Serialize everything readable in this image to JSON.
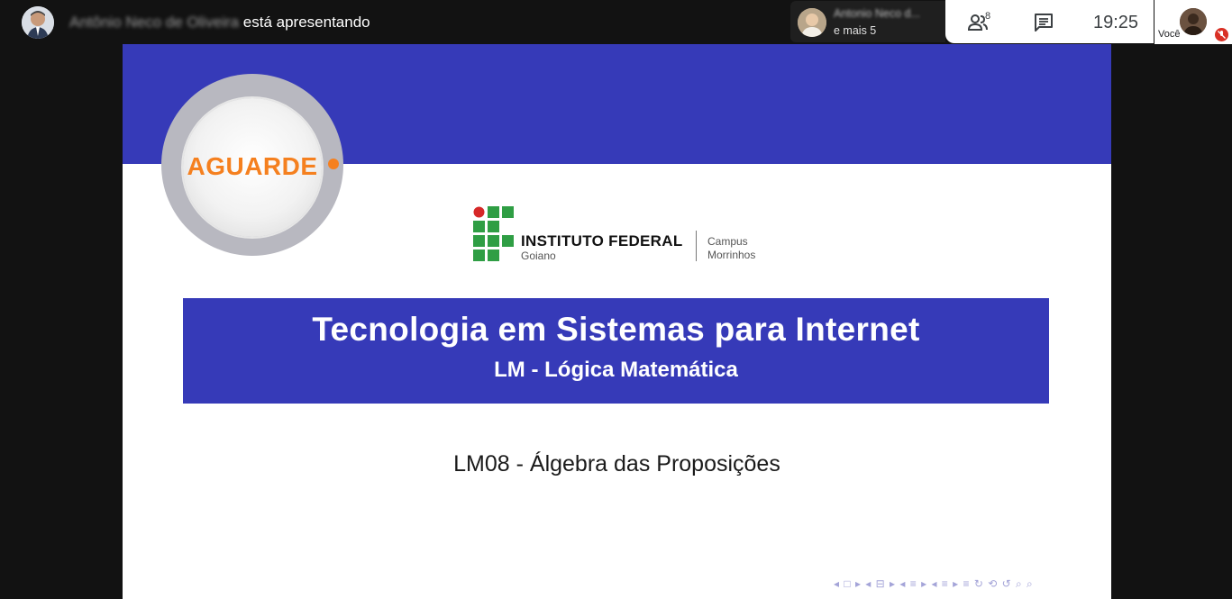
{
  "presenter": {
    "name": "Antônio Neco de Oliveira",
    "status": "está apresentando"
  },
  "participant_tile": {
    "name": "Antonio Neco d...",
    "more": "e mais 5"
  },
  "controls": {
    "people_icon": "people-icon",
    "people_count": "8",
    "chat_icon": "chat-icon",
    "clock": "19:25"
  },
  "self_tile": {
    "label": "Você",
    "mic_icon": "mic-off-icon"
  },
  "slide": {
    "badge": "AGUARDE",
    "institute": {
      "name": "INSTITUTO FEDERAL",
      "state": "Goiano",
      "campus_line1": "Campus",
      "campus_line2": "Morrinhos"
    },
    "course": "Tecnologia em Sistemas para Internet",
    "subject": "LM - Lógica Matemática",
    "lecture": "LM08 - Álgebra das Proposições",
    "nav_symbols": "◂ □ ▸ ◂ ⊟ ▸ ◂ ≡ ▸ ◂ ≡ ▸  ≡ ↻ ⟲ ↺ ⌕ ⌕"
  },
  "colors": {
    "slide_blue": "#363ab8",
    "badge_orange": "#f5801f",
    "ifg_green": "#2f9e44",
    "ifg_red": "#d62828"
  }
}
